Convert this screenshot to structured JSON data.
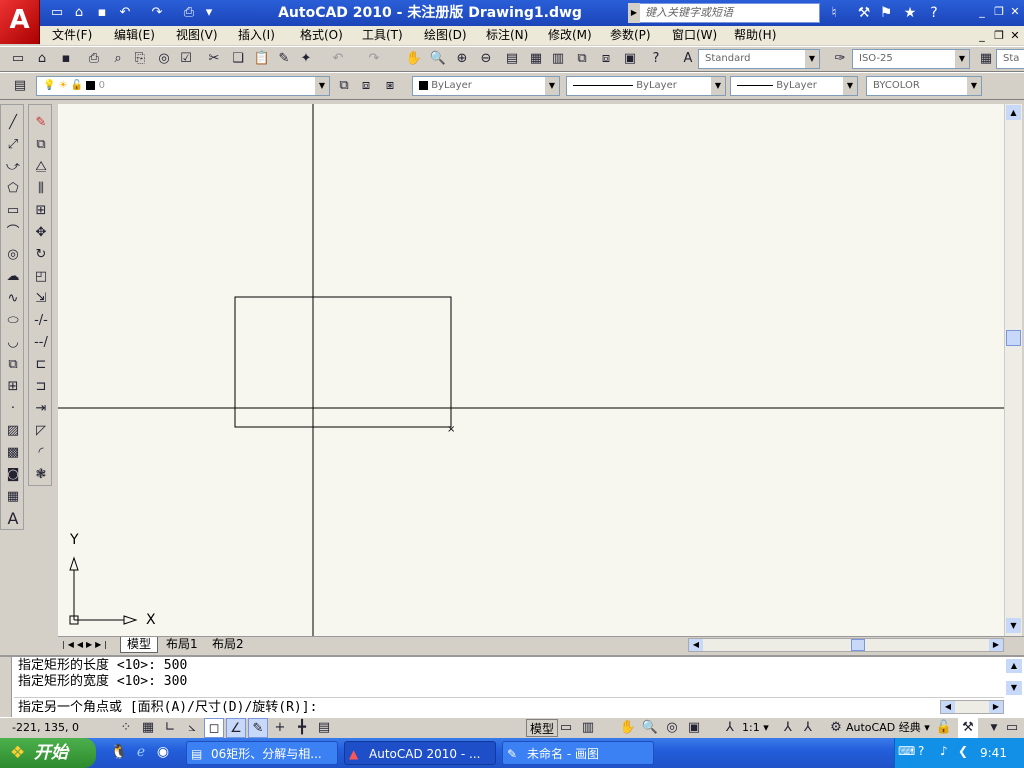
{
  "title": "AutoCAD 2010 - 未注册版  Drawing1.dwg",
  "app_logo": "A",
  "search_placeholder": "键入关键字或短语",
  "menus": [
    "文件(F)",
    "编辑(E)",
    "视图(V)",
    "插入(I)",
    "格式(O)",
    "工具(T)",
    "绘图(D)",
    "标注(N)",
    "修改(M)",
    "参数(P)",
    "窗口(W)",
    "帮助(H)"
  ],
  "style_combos": {
    "text_style": "Standard",
    "dim_style": "ISO-25",
    "table_style": "Sta"
  },
  "layer_combo": "0",
  "property_combos": {
    "color": "ByLayer",
    "linetype": "ByLayer",
    "lineweight": "ByLayer",
    "plotstyle": "BYCOLOR"
  },
  "ucs": {
    "x_label": "X",
    "y_label": "Y"
  },
  "layout_tabs": [
    "模型",
    "布局1",
    "布局2"
  ],
  "command_history": [
    "指定矩形的长度 <10>: 500",
    "指定矩形的宽度 <10>: 300"
  ],
  "command_prompt": "指定另一个角点或 [面积(A)/尺寸(D)/旋转(R)]:",
  "status": {
    "coordinates": "-221, 135, 0",
    "model_label": "模型",
    "annotation_scale": "1:1",
    "workspace": "AutoCAD 经典"
  },
  "taskbar": {
    "start_label": "开始",
    "tasks": [
      "06矩形、分解与相...",
      "AutoCAD 2010 - ...",
      "未命名 - 画图"
    ],
    "clock": "9:41"
  }
}
